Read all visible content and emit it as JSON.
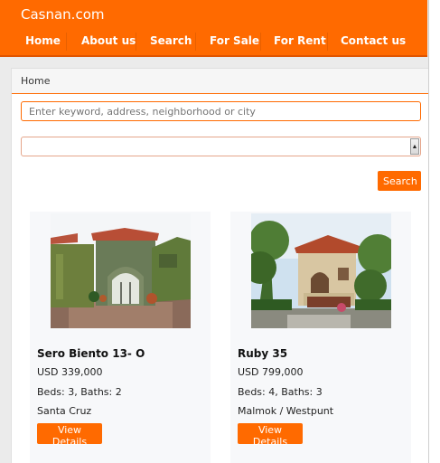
{
  "site": {
    "brand": "Casnan.com"
  },
  "nav": {
    "items": [
      "Home",
      "About us",
      "Search",
      "For Sale",
      "For Rent",
      "Contact us"
    ]
  },
  "breadcrumb": {
    "current": "Home"
  },
  "search": {
    "placeholder": "Enter keyword, address, neighborhood or city",
    "select_value": "",
    "button_label": "Search"
  },
  "listings": [
    {
      "title": "Sero Biento 13- O",
      "price": "USD 339,000",
      "rooms": "Beds: 3, Baths: 2",
      "location": "Santa Cruz",
      "button_label": "View Details"
    },
    {
      "title": "Ruby 35",
      "price": "USD 799,000",
      "rooms": "Beds: 4, Baths: 3",
      "location": "Malmok / Westpunt",
      "button_label": "View Details"
    }
  ],
  "colors": {
    "accent": "#ff6a00",
    "background": "#ebebeb"
  }
}
